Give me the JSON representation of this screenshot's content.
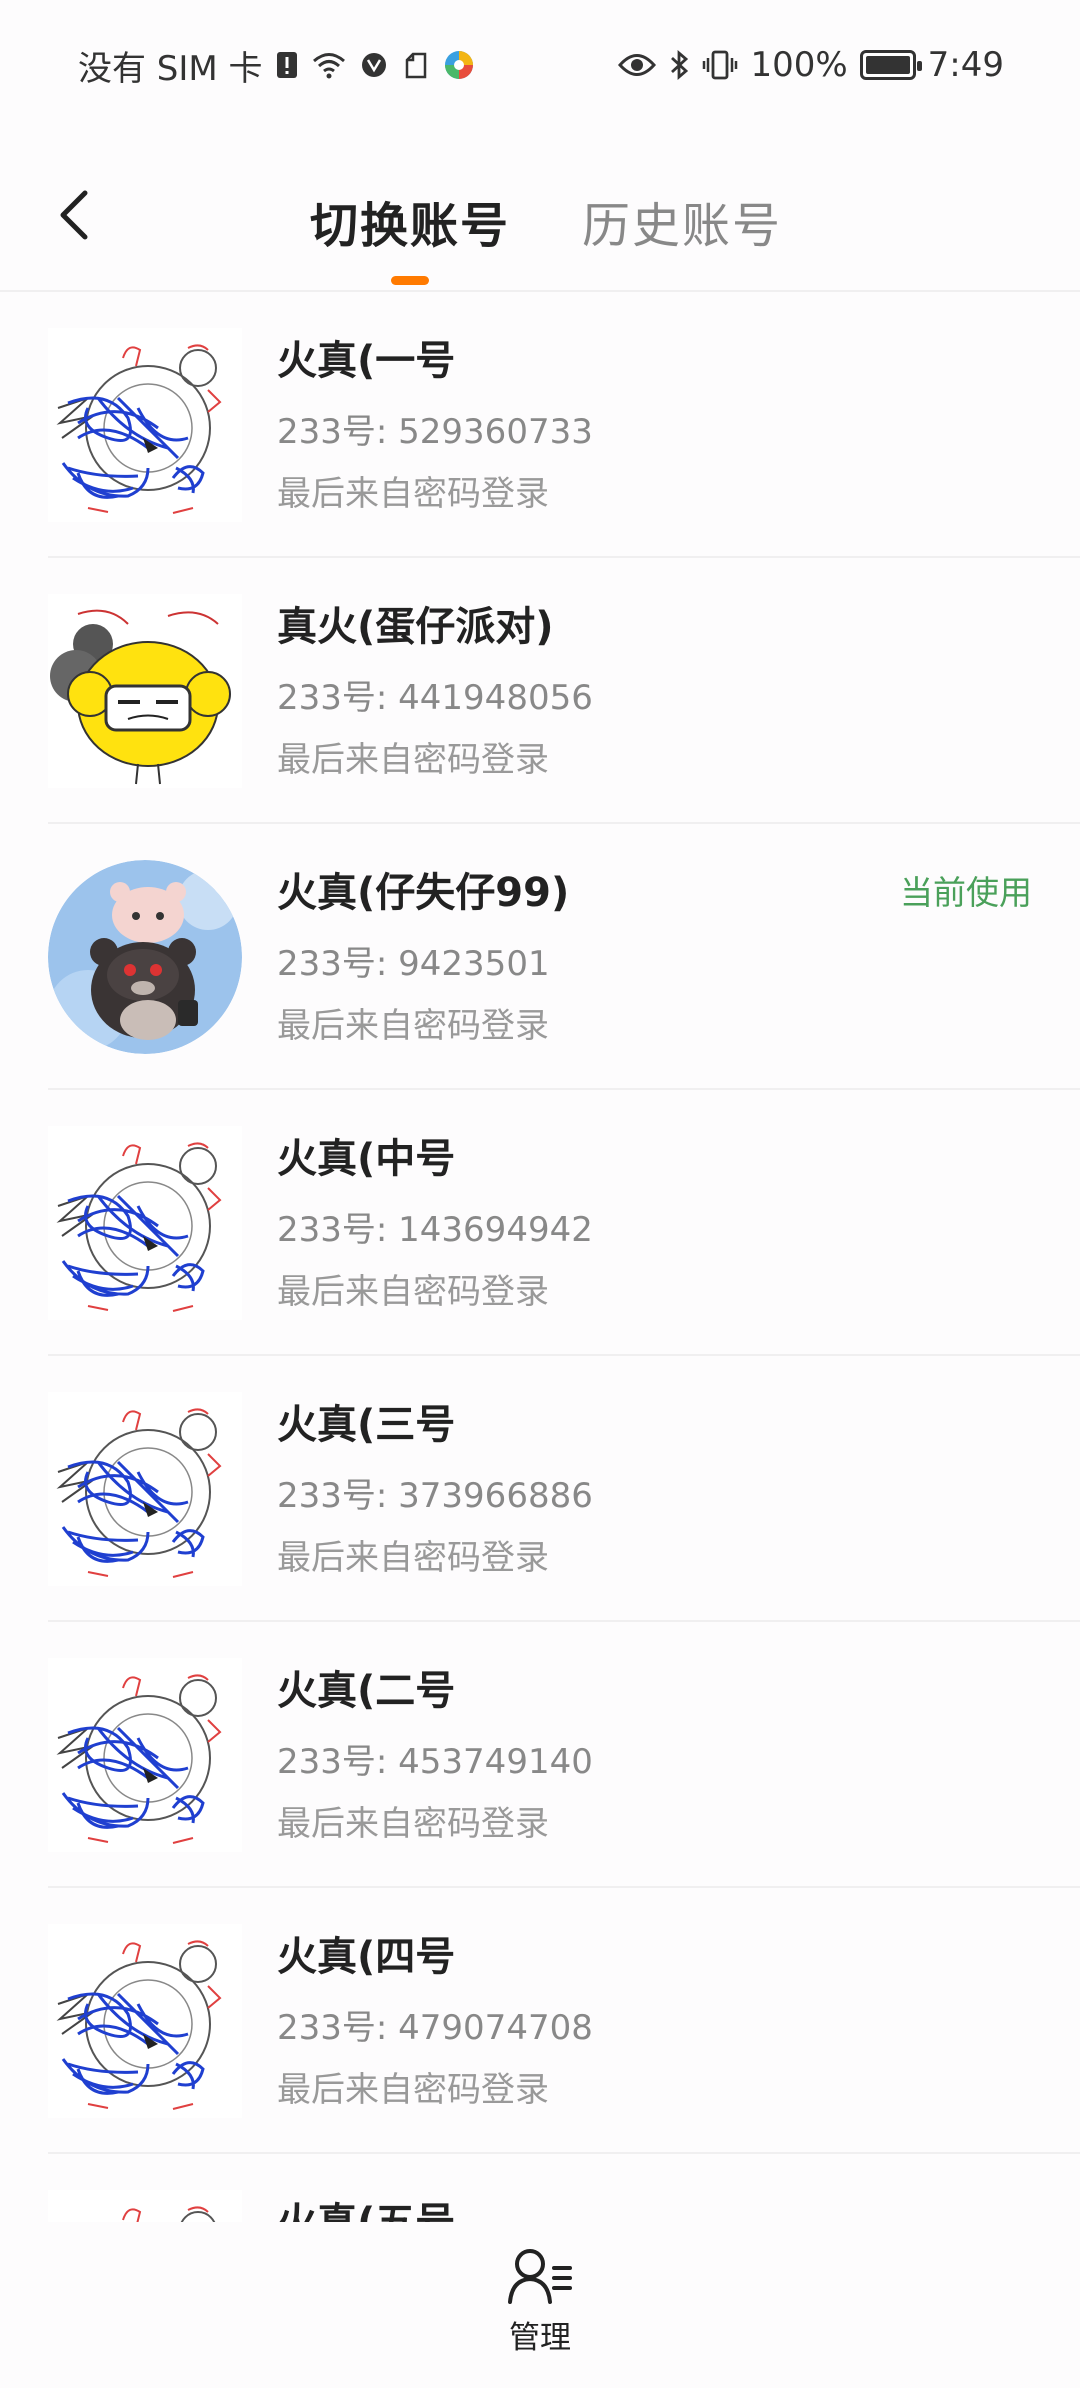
{
  "status_bar": {
    "carrier": "没有 SIM 卡",
    "battery_percent": "100%",
    "time": "7:49",
    "icons": [
      "sim-alert-icon",
      "wifi-icon",
      "vpn-icon",
      "notification-icon",
      "app-icon",
      "eye-icon",
      "bluetooth-icon",
      "vibrate-icon",
      "battery-icon"
    ]
  },
  "header": {
    "back_icon": "chevron-left-icon",
    "tabs": [
      {
        "label": "切换账号",
        "active": true
      },
      {
        "label": "历史账号",
        "active": false
      }
    ],
    "indicator_color": "#ff7a00"
  },
  "accounts": [
    {
      "name": "火真(一号",
      "id": "233号: 529360733",
      "login": "最后来自密码登录",
      "avatar": "sketch-avatar"
    },
    {
      "name": "真火(蛋仔派对)",
      "id": "233号: 441948056",
      "login": "最后来自密码登录",
      "avatar": "yellow-character-avatar"
    },
    {
      "name": "火真(仔失仔99)",
      "id": "233号: 9423501",
      "login": "最后来自密码登录",
      "avatar": "bear-avatar",
      "badge": "当前使用"
    },
    {
      "name": "火真(中号",
      "id": "233号: 143694942",
      "login": "最后来自密码登录",
      "avatar": "sketch-avatar"
    },
    {
      "name": "火真(三号",
      "id": "233号: 373966886",
      "login": "最后来自密码登录",
      "avatar": "sketch-avatar"
    },
    {
      "name": "火真(二号",
      "id": "233号: 453749140",
      "login": "最后来自密码登录",
      "avatar": "sketch-avatar"
    },
    {
      "name": "火真(四号",
      "id": "233号: 479074708",
      "login": "最后来自密码登录",
      "avatar": "sketch-avatar"
    },
    {
      "name": "火真(五号",
      "id": "",
      "login": "",
      "avatar": "sketch-avatar"
    }
  ],
  "current_badge_color": "#4aa05a",
  "bottom_bar": {
    "manage_label": "管理",
    "manage_icon": "user-list-icon"
  }
}
